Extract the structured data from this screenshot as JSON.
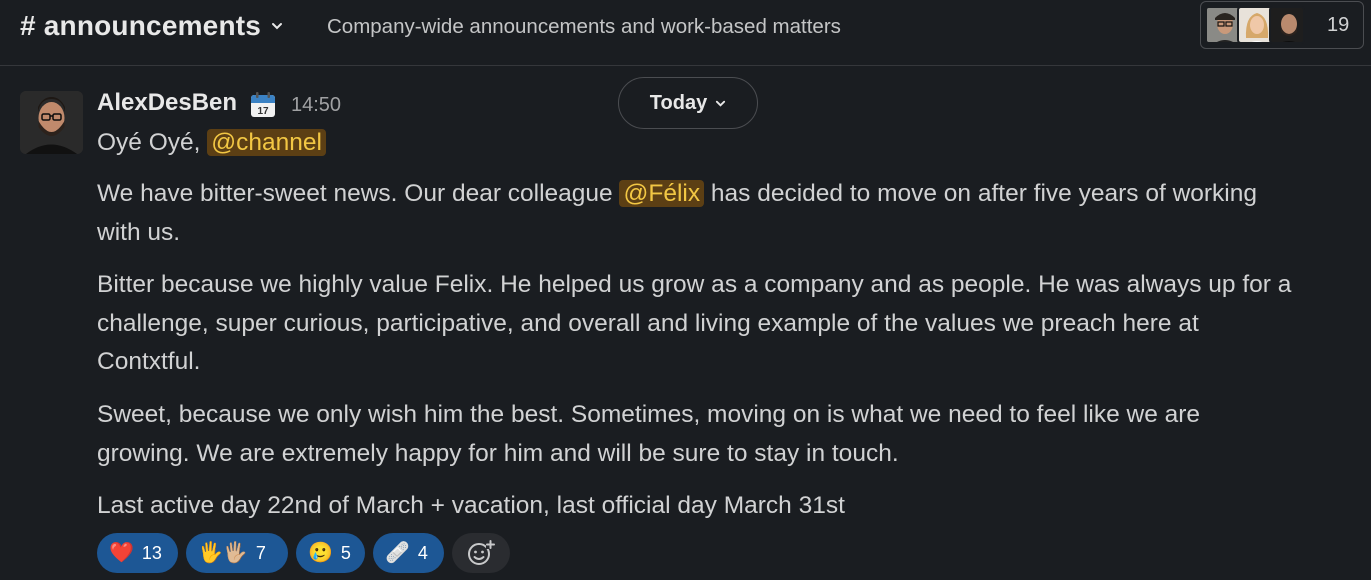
{
  "header": {
    "channel_name": "# announcements",
    "topic": "Company-wide announcements and work-based matters",
    "member_count": "19"
  },
  "message": {
    "author": "AlexDesBen",
    "time": "14:50",
    "greeting_text": "Oyé Oyé, ",
    "greeting_mention": "@channel",
    "p1_before": "We have bitter-sweet news. Our dear colleague ",
    "p1_mention": "@Félix",
    "p1_line1_after": " has decided to move on after five years of working",
    "p1_line2": "with us.",
    "p2_line1": "Bitter because we highly value Felix. He helped us grow as a company and as people. He was always up for a",
    "p2_line2": "challenge, super curious, participative, and overall and living example of the values we preach here at",
    "p2_line3": "Contxtful.",
    "p3_line1": "Sweet, because we only wish him the best. Sometimes, moving on is what we need to feel like we are",
    "p3_line2": "growing. We are extremely happy for him and will be sure to stay in touch.",
    "p4": "Last active day 22nd of March + vacation, last official day March 31st"
  },
  "date_divider": {
    "label": "Today"
  },
  "reactions": [
    {
      "emoji": "❤️",
      "icon": "heart-icon",
      "count": "13"
    },
    {
      "emoji": "🖐️🖐🏼",
      "icon": "raised-hands-icon",
      "count": "7"
    },
    {
      "emoji": "🥲",
      "icon": "smiling-face-with-tear-icon",
      "count": "5"
    },
    {
      "emoji": "🩹",
      "icon": "adhesive-bandage-icon",
      "count": "4"
    }
  ],
  "colors": {
    "background": "#1a1d21",
    "mention_bg": "#5c3f14",
    "mention_fg": "#f2c744",
    "reaction_bg": "#1d5795"
  }
}
